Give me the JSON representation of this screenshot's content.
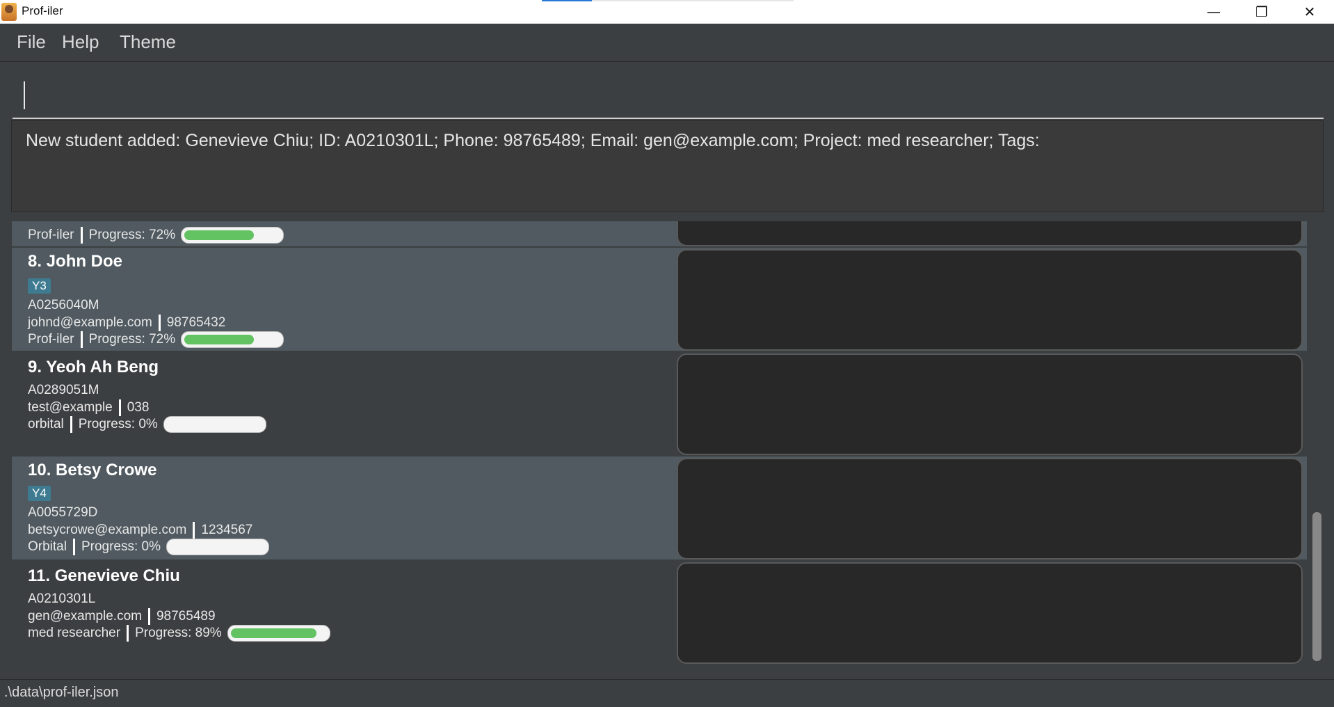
{
  "window": {
    "title": "Prof-iler",
    "minimize": "—",
    "restore": "❐",
    "close": "✕"
  },
  "menu": {
    "file": "File",
    "help": "Help",
    "theme": "Theme"
  },
  "command": {
    "value": ""
  },
  "result": {
    "text": "New student added: Genevieve Chiu; ID: A0210301L; Phone: 98765489; Email: gen@example.com; Project: med researcher; Tags:"
  },
  "students": [
    {
      "project": "Prof-iler",
      "progress_text": "Progress: 72%",
      "progress": 0.72
    },
    {
      "name": "8. John Doe",
      "tag": "Y3",
      "id": "A0256040M",
      "email": "johnd@example.com",
      "phone": "98765432",
      "project": "Prof-iler",
      "progress_text": "Progress: 72%",
      "progress": 0.72
    },
    {
      "name": "9. Yeoh Ah Beng",
      "id": "A0289051M",
      "email": "test@example",
      "phone": "038",
      "project": "orbital",
      "progress_text": "Progress: 0%",
      "progress": 0
    },
    {
      "name": "10. Betsy Crowe",
      "tag": "Y4",
      "id": "A0055729D",
      "email": "betsycrowe@example.com",
      "phone": "1234567",
      "project": "Orbital",
      "progress_text": "Progress: 0%",
      "progress": 0
    },
    {
      "name": "11. Genevieve Chiu",
      "id": "A0210301L",
      "email": "gen@example.com",
      "phone": "98765489",
      "project": "med researcher",
      "progress_text": "Progress: 89%",
      "progress": 0.89
    }
  ],
  "status": {
    "path": ".\\data\\prof-iler.json"
  },
  "colors": {
    "progress_fill": "#63c363",
    "tag_bg": "#3e7b91",
    "selected_row": "#505a60"
  }
}
